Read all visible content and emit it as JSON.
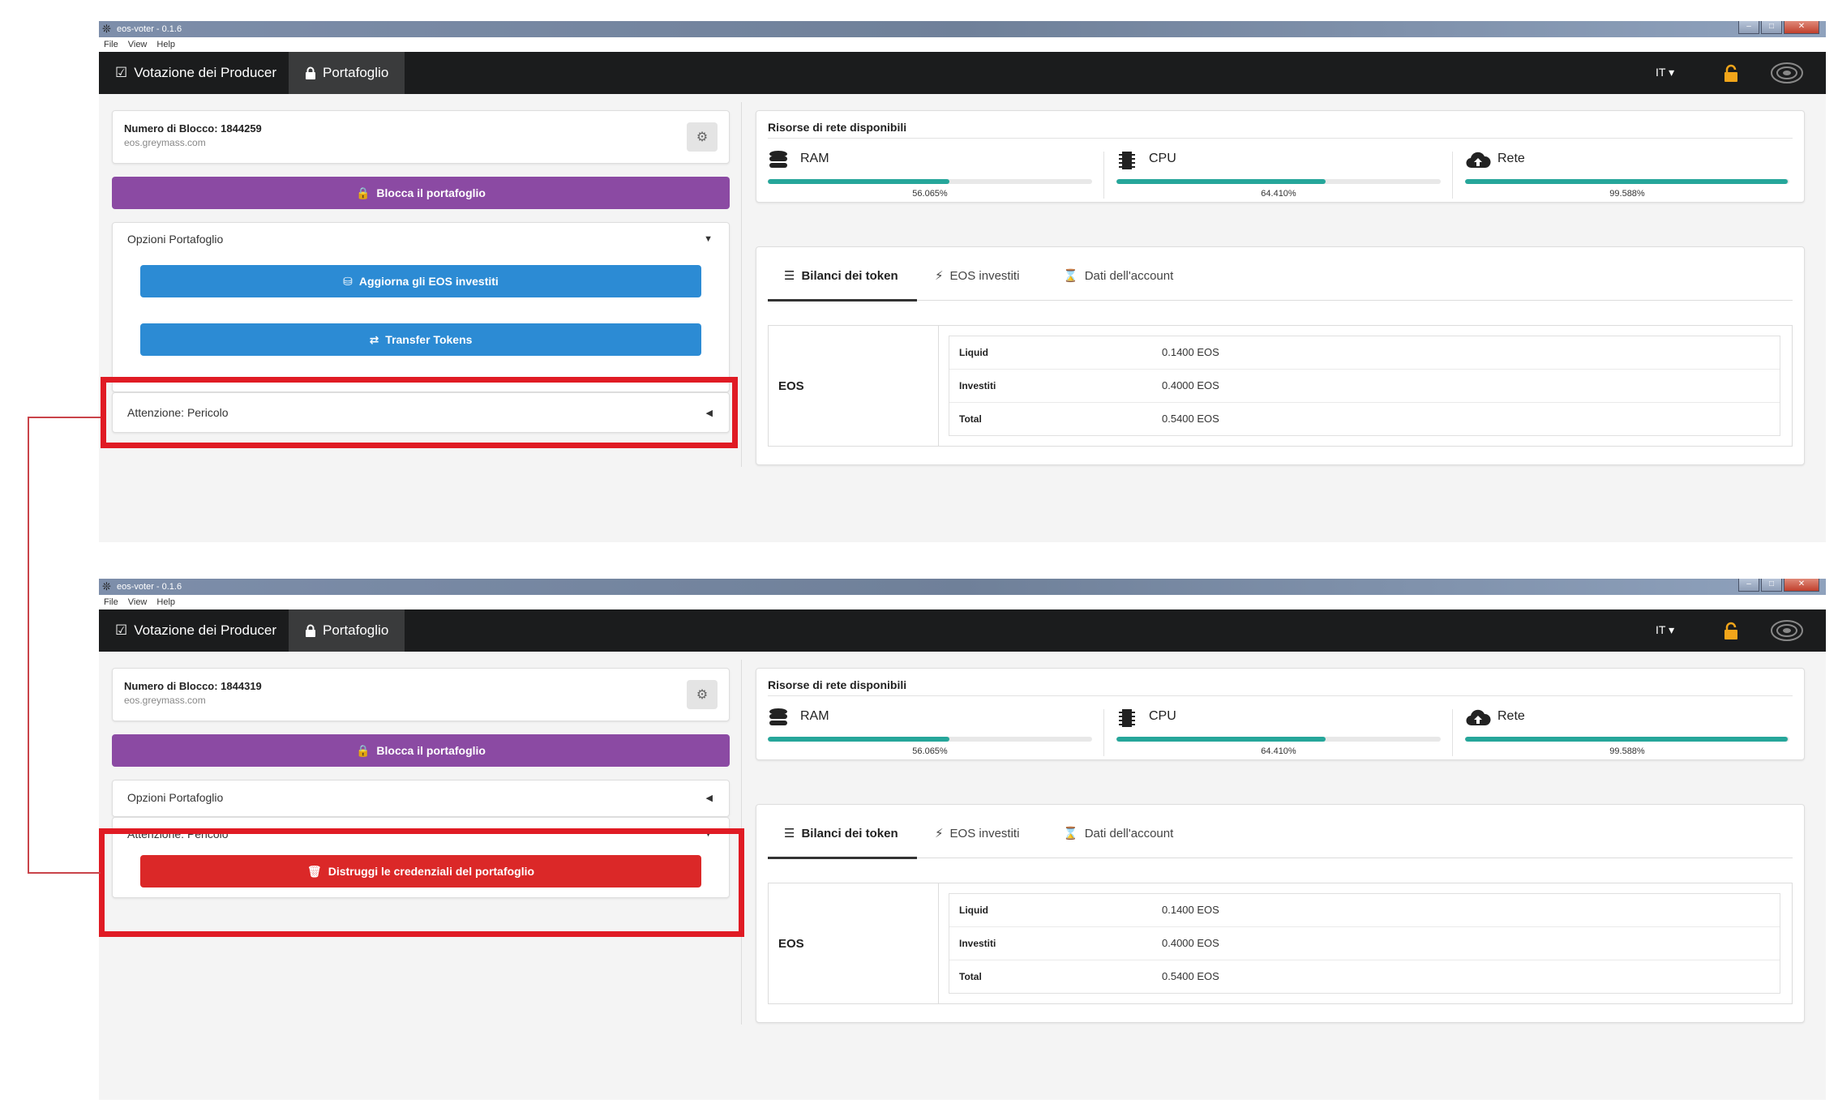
{
  "window": {
    "title": "eos-voter - 0.1.6",
    "menu": [
      "File",
      "View",
      "Help"
    ]
  },
  "nav": {
    "tab_vote": "Votazione dei Producer",
    "tab_wallet": "Portafoglio",
    "lang": "IT"
  },
  "screen1": {
    "block_label": "Numero di Blocco: 1844259",
    "node": "eos.greymass.com",
    "lock_button": "Blocca il portafoglio",
    "wallet_options": "Opzioni Portafoglio",
    "update_stake_button": "Aggiorna gli EOS investiti",
    "transfer_button": "Transfer Tokens",
    "danger_title": "Attenzione: Pericolo"
  },
  "screen2": {
    "block_label": "Numero di Blocco: 1844319",
    "node": "eos.greymass.com",
    "lock_button": "Blocca il portafoglio",
    "wallet_options": "Opzioni Portafoglio",
    "danger_title": "Attenzione: Pericolo",
    "destroy_button": "Distruggi le credenziali del portafoglio"
  },
  "resources": {
    "title": "Risorse di rete disponibili",
    "ram": {
      "label": "RAM",
      "percent_text": "56.065%",
      "fraction": 0.56065
    },
    "cpu": {
      "label": "CPU",
      "percent_text": "64.410%",
      "fraction": 0.6441
    },
    "net": {
      "label": "Rete",
      "percent_text": "99.588%",
      "fraction": 0.99588
    }
  },
  "tabs": {
    "balances": "Bilanci dei token",
    "staked": "EOS investiti",
    "account": "Dati dell'account"
  },
  "balances": {
    "symbol": "EOS",
    "rows": [
      {
        "label": "Liquid",
        "value": "0.1400 EOS"
      },
      {
        "label": "Investiti",
        "value": "0.4000 EOS"
      },
      {
        "label": "Total",
        "value": "0.5400 EOS"
      }
    ]
  },
  "colors": {
    "highlight": "#e01b24",
    "purple": "#8b4aa3",
    "blue": "#2c8bd4",
    "red": "#db2828",
    "teal": "#26a69a"
  }
}
